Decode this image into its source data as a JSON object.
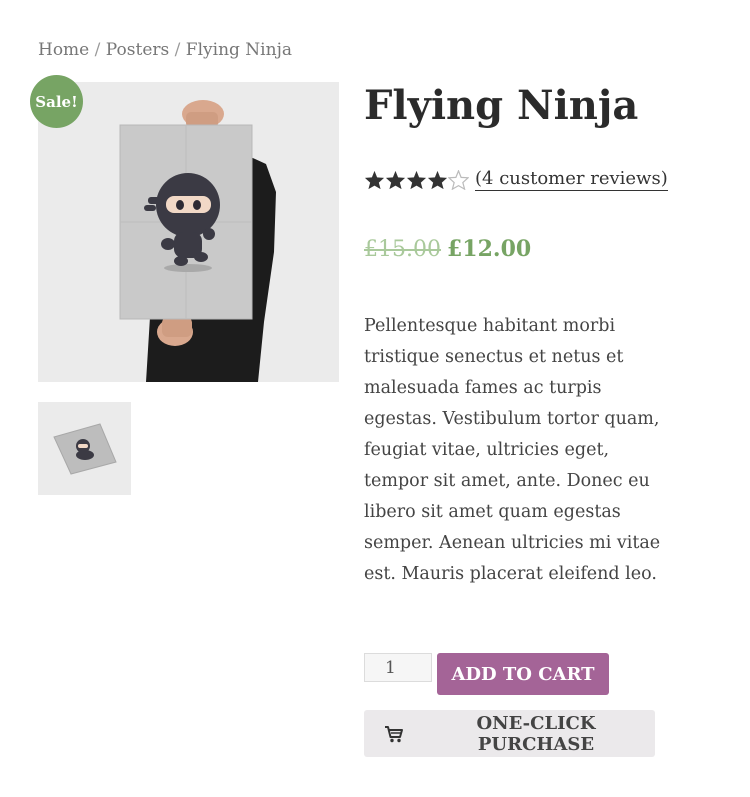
{
  "breadcrumb": {
    "items": [
      "Home",
      "Posters",
      "Flying Ninja"
    ],
    "separator": "/"
  },
  "product": {
    "sale_badge": "Sale!",
    "title": "Flying Ninja",
    "rating": 4,
    "rating_max": 5,
    "reviews_link": "(4 customer reviews)",
    "price_old": "£15.00",
    "price_new": "£12.00",
    "description": "Pellentesque habitant morbi tristique senectus et netus et malesuada fames ac turpis egestas. Vestibulum tortor quam, feugiat vitae, ultricies eget, tempor sit amet, ante. Donec eu libero sit amet quam egestas semper. Aenean ultricies mi vitae est. Mauris placerat eleifend leo."
  },
  "purchase": {
    "quantity": "1",
    "add_to_cart_label": "ADD TO CART",
    "one_click_label": "ONE-CLICK PURCHASE"
  },
  "colors": {
    "sale": "#77a464",
    "price": "#77a464",
    "add_to_cart": "#a46497",
    "one_click_bg": "#ebe9eb"
  },
  "icons": {
    "cart": "shopping-cart-icon",
    "star": "star-icon"
  }
}
